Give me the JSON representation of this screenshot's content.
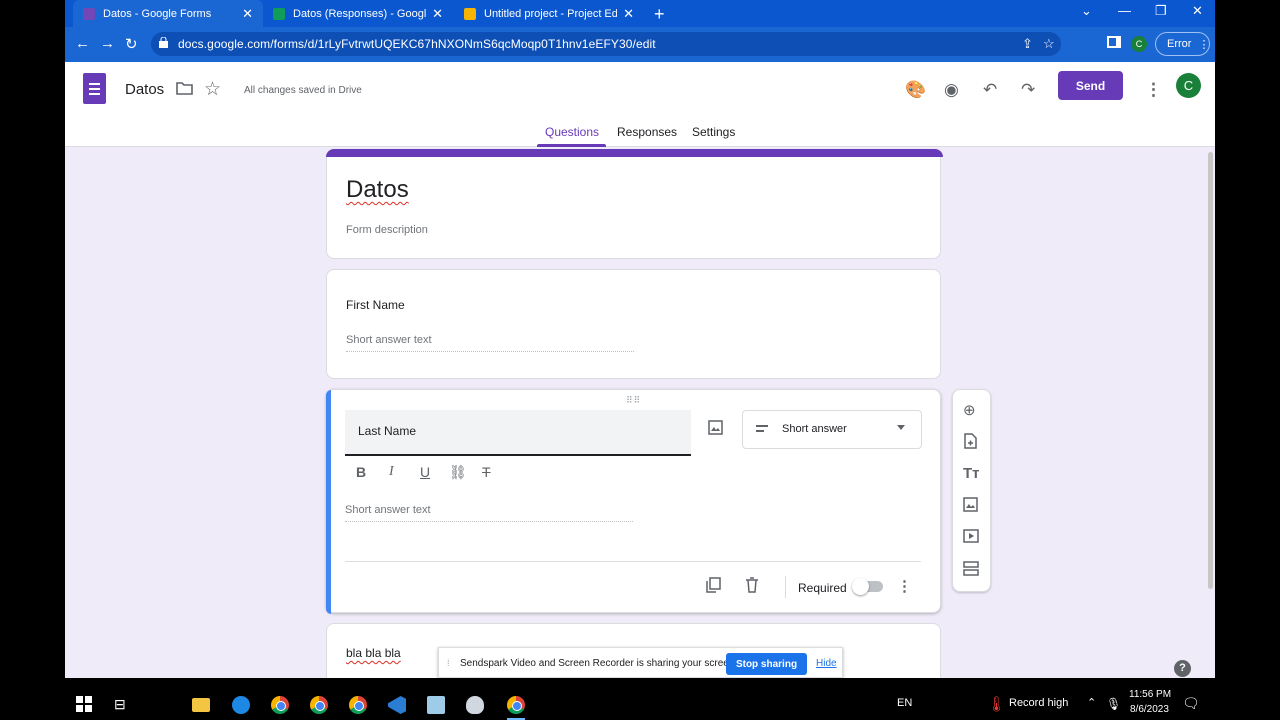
{
  "browser": {
    "tabs": [
      {
        "title": "Datos - Google Forms",
        "active": true,
        "favicon_color": "#7248b9"
      },
      {
        "title": "Datos (Responses) - Google Shee",
        "active": false,
        "favicon_color": "#0f9d58"
      },
      {
        "title": "Untitled project - Project Editor -",
        "active": false,
        "favicon_color": "#f4b400"
      }
    ],
    "url": "docs.google.com/forms/d/1rLyFvtrwtUQEKC67hNXONmS6qcMoqp0T1hnv1eEFY30/edit",
    "profile_letter": "C",
    "error_label": "Error"
  },
  "app": {
    "title": "Datos",
    "save_status": "All changes saved in Drive",
    "send_label": "Send",
    "avatar_letter": "C",
    "tabs": [
      "Questions",
      "Responses",
      "Settings"
    ],
    "selected_tab": "Questions",
    "accent": "#673ab7"
  },
  "form": {
    "title": "Datos",
    "description_placeholder": "Form description",
    "questions": [
      {
        "label": "First Name",
        "answer_placeholder": "Short answer text"
      },
      {
        "label": "Last Name",
        "answer_placeholder": "Short answer text",
        "type": "Short answer",
        "required_label": "Required",
        "required": false
      },
      {
        "label": "bla bla bla"
      }
    ]
  },
  "share_bar": {
    "message": "Sendspark Video and Screen Recorder is sharing your screen.",
    "stop_label": "Stop sharing",
    "hide_label": "Hide"
  },
  "taskbar": {
    "language": "EN",
    "weather": "Record high",
    "time": "11:56 PM",
    "date": "8/6/2023"
  }
}
